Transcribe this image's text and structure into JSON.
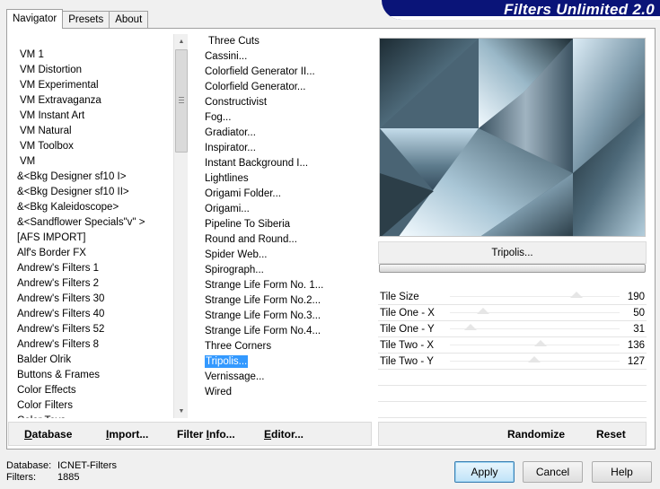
{
  "app": {
    "title": "Filters Unlimited 2.0"
  },
  "tabs": [
    {
      "label": "Navigator",
      "active": true
    },
    {
      "label": "Presets",
      "active": false
    },
    {
      "label": "About",
      "active": false
    }
  ],
  "categories": [
    "VM 1",
    "VM Distortion",
    "VM Experimental",
    "VM Extravaganza",
    "VM Instant Art",
    "VM Natural",
    "VM Toolbox",
    "VM",
    "&<Bkg Designer sf10 I>",
    "&<Bkg Designer sf10 II>",
    "&<Bkg Kaleidoscope>",
    "&<Sandflower Specials\"v\" >",
    "[AFS IMPORT]",
    "Alf's Border FX",
    "Andrew's Filters 1",
    "Andrew's Filters 2",
    "Andrew's Filters 30",
    "Andrew's Filters 40",
    "Andrew's Filters 52",
    "Andrew's Filters 8",
    "Balder Olrik",
    "Buttons & Frames",
    "Color Effects",
    "Color Filters",
    "Color Toys"
  ],
  "filters": [
    "Three Cuts",
    "Cassini...",
    "Colorfield Generator II...",
    "Colorfield Generator...",
    "Constructivist",
    "Fog...",
    "Gradiator...",
    "Inspirator...",
    "Instant Background I...",
    "Lightlines",
    "Origami Folder...",
    "Origami...",
    "Pipeline To Siberia",
    "Round and Round...",
    "Spider Web...",
    "Spirograph...",
    "Strange Life Form No. 1...",
    "Strange Life Form No.2...",
    "Strange Life Form No.3...",
    "Strange Life Form No.4...",
    "Three Corners",
    "Tripolis...",
    "Vernissage...",
    "Wired"
  ],
  "selected_filter_index": 21,
  "current_filter": "Tripolis...",
  "params": [
    {
      "label": "Tile Size",
      "value": "190",
      "fraction": 0.745
    },
    {
      "label": "Tile One - X",
      "value": "50",
      "fraction": 0.196
    },
    {
      "label": "Tile One - Y",
      "value": "31",
      "fraction": 0.122
    },
    {
      "label": "Tile Two - X",
      "value": "136",
      "fraction": 0.533
    },
    {
      "label": "Tile Two - Y",
      "value": "127",
      "fraction": 0.498
    }
  ],
  "toolbar": {
    "database": {
      "u": "D",
      "rest": "atabase"
    },
    "import": {
      "u": "I",
      "rest": "mport..."
    },
    "filter_info": {
      "pre": "Filter ",
      "u": "I",
      "rest": "nfo..."
    },
    "editor": {
      "u": "E",
      "rest": "ditor..."
    },
    "randomize": "Randomize",
    "reset": "Reset"
  },
  "status": {
    "database_label": "Database:",
    "database_value": "ICNET-Filters",
    "filters_label": "Filters:",
    "filters_value": "1885"
  },
  "buttons": {
    "apply": "Apply",
    "cancel": "Cancel",
    "help": "Help"
  },
  "colors": {
    "banner": "#0a1478",
    "selection": "#3399ff",
    "preview_dark": "#2a3c46",
    "preview_light": "#e8f4ff"
  }
}
